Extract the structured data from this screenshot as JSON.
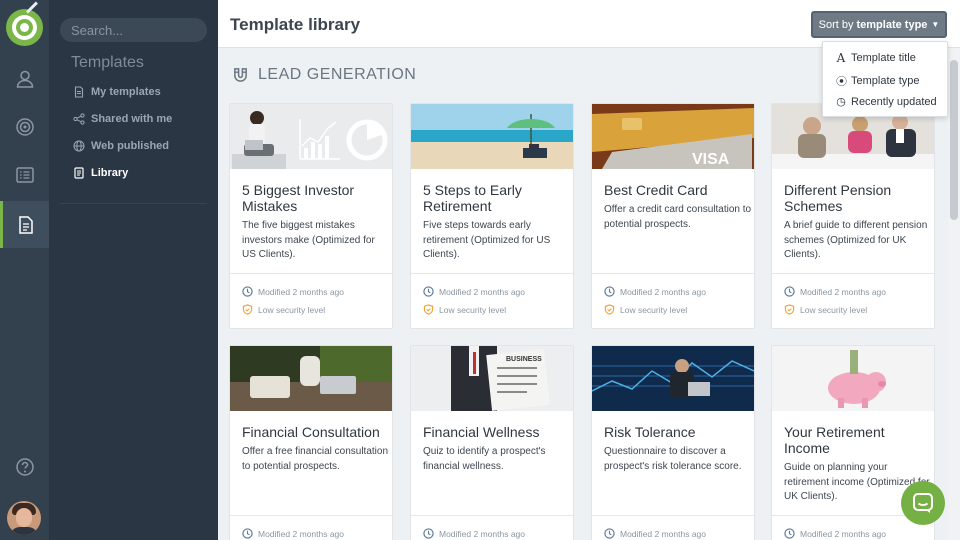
{
  "nav": {
    "search_placeholder": "Search...",
    "title": "Templates",
    "items": [
      {
        "label": "My templates",
        "icon": "document-icon"
      },
      {
        "label": "Shared with me",
        "icon": "share-icon"
      },
      {
        "label": "Web published",
        "icon": "globe-icon"
      },
      {
        "label": "Library",
        "icon": "book-icon",
        "active": true
      }
    ]
  },
  "header": {
    "title": "Template library",
    "sort_prefix": "Sort by",
    "sort_value": "template type"
  },
  "sort_menu": {
    "items": [
      {
        "label": "Template title",
        "icon": "letter-a-icon"
      },
      {
        "label": "Template type",
        "icon": "radio-icon"
      },
      {
        "label": "Recently updated",
        "icon": "clock-icon"
      }
    ]
  },
  "section": {
    "title": "LEAD GENERATION",
    "icon": "magnet-icon"
  },
  "cards": [
    {
      "title": "5 Biggest Investor Mistakes",
      "desc": "The five biggest mistakes investors make (Optimized for US Clients).",
      "modified": "Modified 2 months ago",
      "security": "Low security level"
    },
    {
      "title": "5 Steps to Early Retirement",
      "desc": "Five steps towards early retirement (Optimized for US Clients).",
      "modified": "Modified 2 months ago",
      "security": "Low security level"
    },
    {
      "title": "Best Credit Card",
      "desc": "Offer a credit card consultation to potential prospects.",
      "modified": "Modified 2 months ago",
      "security": "Low security level"
    },
    {
      "title": "Different Pension Schemes",
      "desc": "A brief guide to different pension schemes (Optimized for UK Clients).",
      "modified": "Modified 2 months ago",
      "security": "Low security level"
    },
    {
      "title": "Financial Consultation",
      "desc": "Offer a free financial consultation to potential prospects.",
      "modified": "Modified 2 months ago"
    },
    {
      "title": "Financial Wellness",
      "desc": "Quiz to identify a prospect's financial wellness.",
      "modified": "Modified 2 months ago"
    },
    {
      "title": "Risk Tolerance",
      "desc": "Questionnaire to discover a prospect's risk tolerance score.",
      "modified": "Modified 2 months ago"
    },
    {
      "title": "Your Retirement Income",
      "desc": "Guide on planning your retirement income (Optimized for UK Clients).",
      "modified": "Modified 2 months ago"
    }
  ],
  "image_texts": {
    "card2_visa": "VISA",
    "card6_newspaper": "BUSINESS"
  },
  "colors": {
    "accent": "#7ab648",
    "rail": "#33414f",
    "nav": "#2a3644",
    "security_icon": "#f0a030",
    "link_icon": "#5a7a9a"
  }
}
